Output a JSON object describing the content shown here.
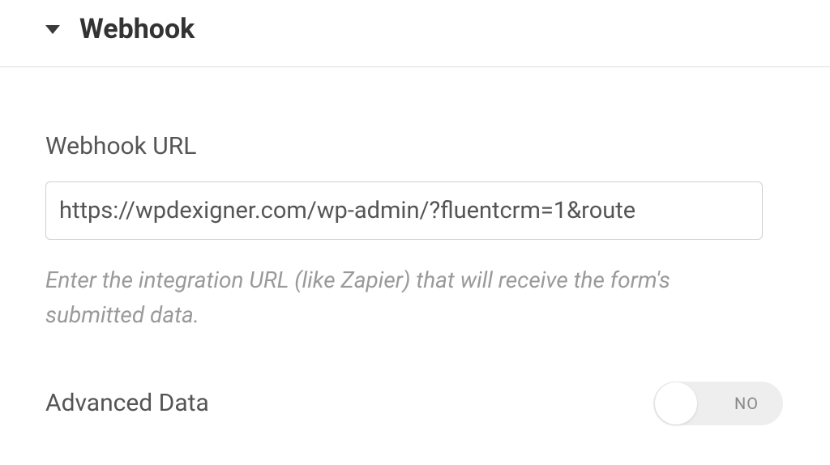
{
  "header": {
    "title": "Webhook"
  },
  "form": {
    "url_label": "Webhook URL",
    "url_value": "https://wpdexigner.com/wp-admin/?fluentcrm=1&route",
    "url_helper": "Enter the integration URL (like Zapier) that will receive the form's submitted data."
  },
  "advanced": {
    "label": "Advanced Data",
    "toggle_state": "NO"
  }
}
